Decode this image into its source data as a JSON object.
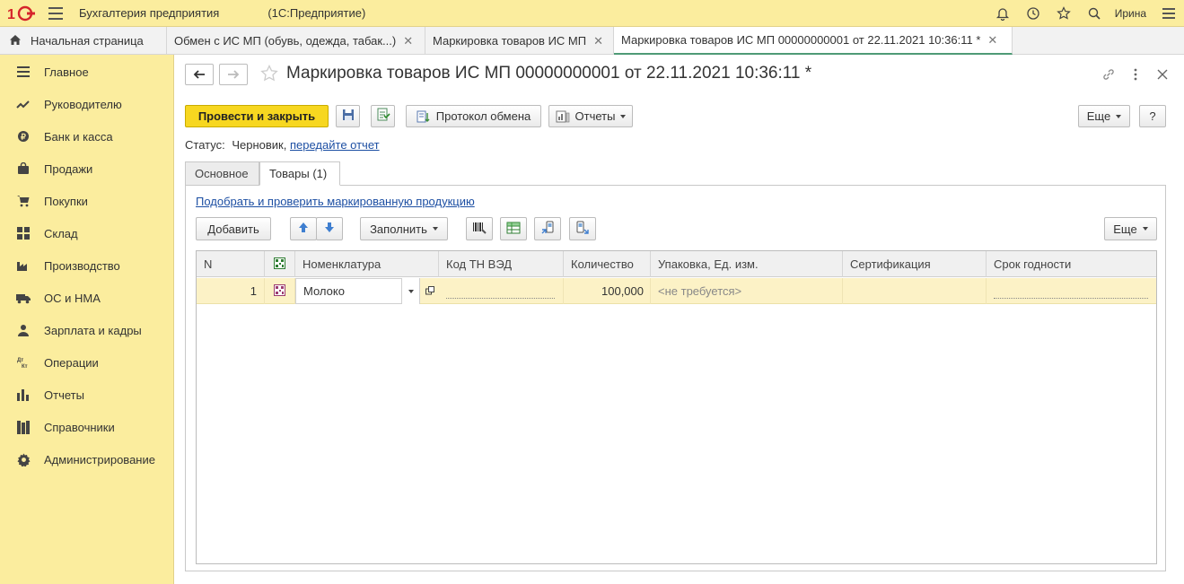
{
  "app": {
    "title": "Бухгалтерия предприятия",
    "subtitle": "(1С:Предприятие)",
    "user": "Ирина"
  },
  "tabs": [
    {
      "label": "Начальная страница"
    },
    {
      "label": "Обмен с ИС МП (обувь, одежда, табак...)"
    },
    {
      "label": "Маркировка товаров ИС МП"
    },
    {
      "label": "Маркировка товаров ИС МП 00000000001 от 22.11.2021 10:36:11 *"
    }
  ],
  "sidebar": {
    "items": [
      {
        "label": "Главное",
        "icon": "menu-lines-icon"
      },
      {
        "label": "Руководителю",
        "icon": "trend-icon"
      },
      {
        "label": "Банк и касса",
        "icon": "coin-icon"
      },
      {
        "label": "Продажи",
        "icon": "bag-icon"
      },
      {
        "label": "Покупки",
        "icon": "cart-icon"
      },
      {
        "label": "Склад",
        "icon": "grid-icon"
      },
      {
        "label": "Производство",
        "icon": "factory-icon"
      },
      {
        "label": "ОС и НМА",
        "icon": "truck-icon"
      },
      {
        "label": "Зарплата и кадры",
        "icon": "person-icon"
      },
      {
        "label": "Операции",
        "icon": "dt-kt-icon"
      },
      {
        "label": "Отчеты",
        "icon": "bars-icon"
      },
      {
        "label": "Справочники",
        "icon": "books-icon"
      },
      {
        "label": "Администрирование",
        "icon": "gear-icon"
      }
    ]
  },
  "document": {
    "title": "Маркировка товаров ИС МП 00000000001 от 22.11.2021 10:36:11 *"
  },
  "toolbar": {
    "post_close": "Провести и закрыть",
    "exchange_log": "Протокол обмена",
    "reports": "Отчеты",
    "more": "Еще",
    "help": "?"
  },
  "status": {
    "label": "Статус:",
    "value": "Черновик,",
    "link": "передайте отчет"
  },
  "form_tabs": {
    "main": "Основное",
    "goods": "Товары (1)"
  },
  "goods": {
    "pick_link": "Подобрать и проверить маркированную продукцию",
    "add": "Добавить",
    "fill": "Заполнить",
    "more": "Еще",
    "columns": {
      "n": "N",
      "nomenclature": "Номенклатура",
      "tnved": "Код ТН ВЭД",
      "qty": "Количество",
      "pack": "Упаковка, Ед. изм.",
      "cert": "Сертификация",
      "expiry": "Срок годности"
    },
    "rows": [
      {
        "n": "1",
        "nomenclature": "Молоко",
        "tnved": "",
        "qty": "100,000",
        "pack": "<не требуется>",
        "cert": "",
        "expiry": ""
      }
    ]
  },
  "colors": {
    "sidebar_bg": "#fbed9e",
    "primary_button": "#f7d720",
    "link": "#1d4fa3",
    "active_tab_underline": "#4f9a76",
    "row_highlight": "#fcf2c6"
  }
}
